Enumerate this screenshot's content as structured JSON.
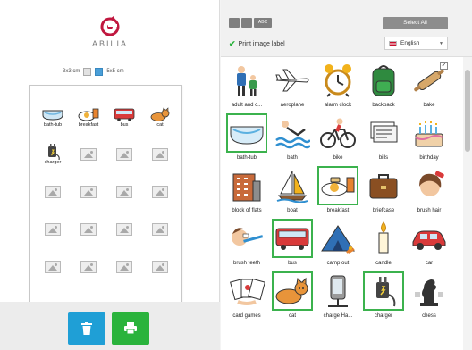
{
  "brand": {
    "name": "ABILIA",
    "accent": "#c0173f"
  },
  "grid_size": {
    "small_label": "3x3 cm",
    "large_label": "5x5 cm",
    "selected": "small"
  },
  "sheet": {
    "cells": [
      {
        "label": "bath-tub",
        "icon": "bathtub-icon"
      },
      {
        "label": "breakfast",
        "icon": "breakfast-icon"
      },
      {
        "label": "bus",
        "icon": "bus-icon"
      },
      {
        "label": "cat",
        "icon": "cat-icon"
      },
      {
        "label": "charger",
        "icon": "charger-icon"
      }
    ],
    "empty_slots": 19
  },
  "footer": {
    "delete_icon": "trash-icon",
    "print_icon": "printer-icon"
  },
  "toolbar": {
    "view_buttons": [
      "grid-large-icon",
      "grid-small-icon",
      "ABC"
    ],
    "select_all": "Select All",
    "print_label": "Print image label",
    "print_label_checked": true,
    "language": "English"
  },
  "library": [
    {
      "label": "adult and c...",
      "icon": "family-icon",
      "selected": false
    },
    {
      "label": "aeroplane",
      "icon": "aeroplane-icon",
      "selected": false
    },
    {
      "label": "alarm clock",
      "icon": "alarm-clock-icon",
      "selected": false
    },
    {
      "label": "backpack",
      "icon": "backpack-icon",
      "selected": false
    },
    {
      "label": "bake",
      "icon": "rolling-pin-icon",
      "selected": false,
      "checkbox": true
    },
    {
      "label": "bath-tub",
      "icon": "bathtub-icon",
      "selected": true
    },
    {
      "label": "bath",
      "icon": "swimmer-icon",
      "selected": false
    },
    {
      "label": "bike",
      "icon": "bike-icon",
      "selected": false
    },
    {
      "label": "bills",
      "icon": "bills-icon",
      "selected": false
    },
    {
      "label": "birthday",
      "icon": "cake-icon",
      "selected": false
    },
    {
      "label": "block of flats",
      "icon": "building-icon",
      "selected": false
    },
    {
      "label": "boat",
      "icon": "sailboat-icon",
      "selected": false
    },
    {
      "label": "breakfast",
      "icon": "breakfast-icon",
      "selected": true
    },
    {
      "label": "briefcase",
      "icon": "briefcase-icon",
      "selected": false
    },
    {
      "label": "brush hair",
      "icon": "brush-hair-icon",
      "selected": false
    },
    {
      "label": "brush teeth",
      "icon": "toothbrush-icon",
      "selected": false
    },
    {
      "label": "bus",
      "icon": "bus-icon",
      "selected": true
    },
    {
      "label": "camp out",
      "icon": "tent-icon",
      "selected": false
    },
    {
      "label": "candle",
      "icon": "candle-icon",
      "selected": false
    },
    {
      "label": "car",
      "icon": "car-icon",
      "selected": false
    },
    {
      "label": "card games",
      "icon": "cards-icon",
      "selected": false
    },
    {
      "label": "cat",
      "icon": "cat-icon",
      "selected": true
    },
    {
      "label": "charge Ha...",
      "icon": "charge-device-icon",
      "selected": false
    },
    {
      "label": "charger",
      "icon": "charger-icon",
      "selected": true
    },
    {
      "label": "chess",
      "icon": "chess-icon",
      "selected": false
    }
  ]
}
